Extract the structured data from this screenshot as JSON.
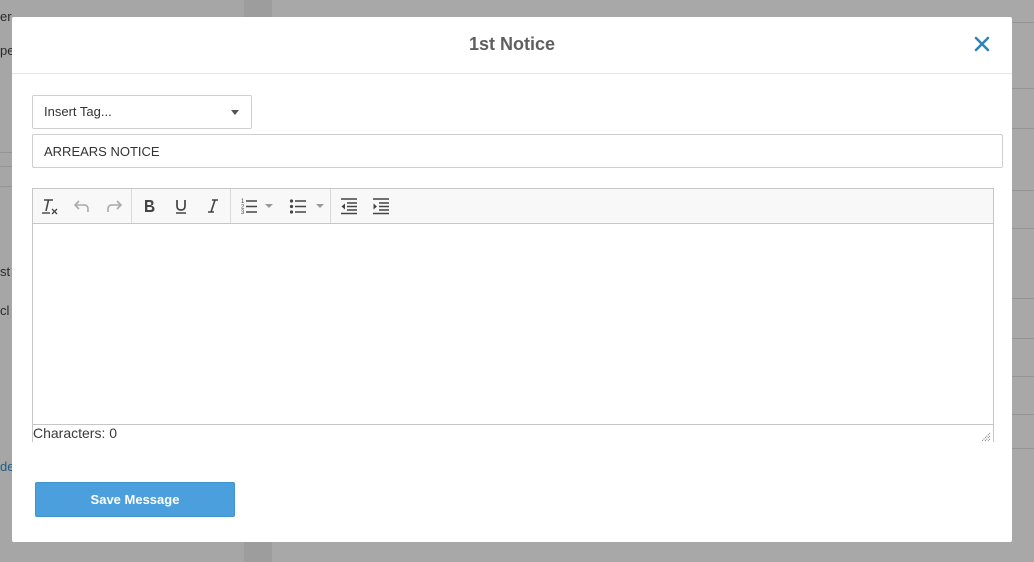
{
  "background": {
    "fragments": [
      "er.",
      "pe",
      "st",
      "cl",
      "de"
    ]
  },
  "modal": {
    "title": "1st Notice",
    "insert_tag_label": "Insert Tag...",
    "subject_value": "ARREARS NOTICE",
    "editor": {
      "toolbar": [
        "remove-format",
        "undo",
        "redo",
        "bold",
        "underline",
        "italic",
        "numbered-list",
        "bulleted-list",
        "outdent",
        "indent"
      ],
      "characters_label": "Characters: 0"
    },
    "save_label": "Save Message"
  },
  "colors": {
    "accent": "#4a9fdc",
    "close": "#2f86b8",
    "title": "#5f5f5f",
    "overlay": "#a9a9a9"
  }
}
